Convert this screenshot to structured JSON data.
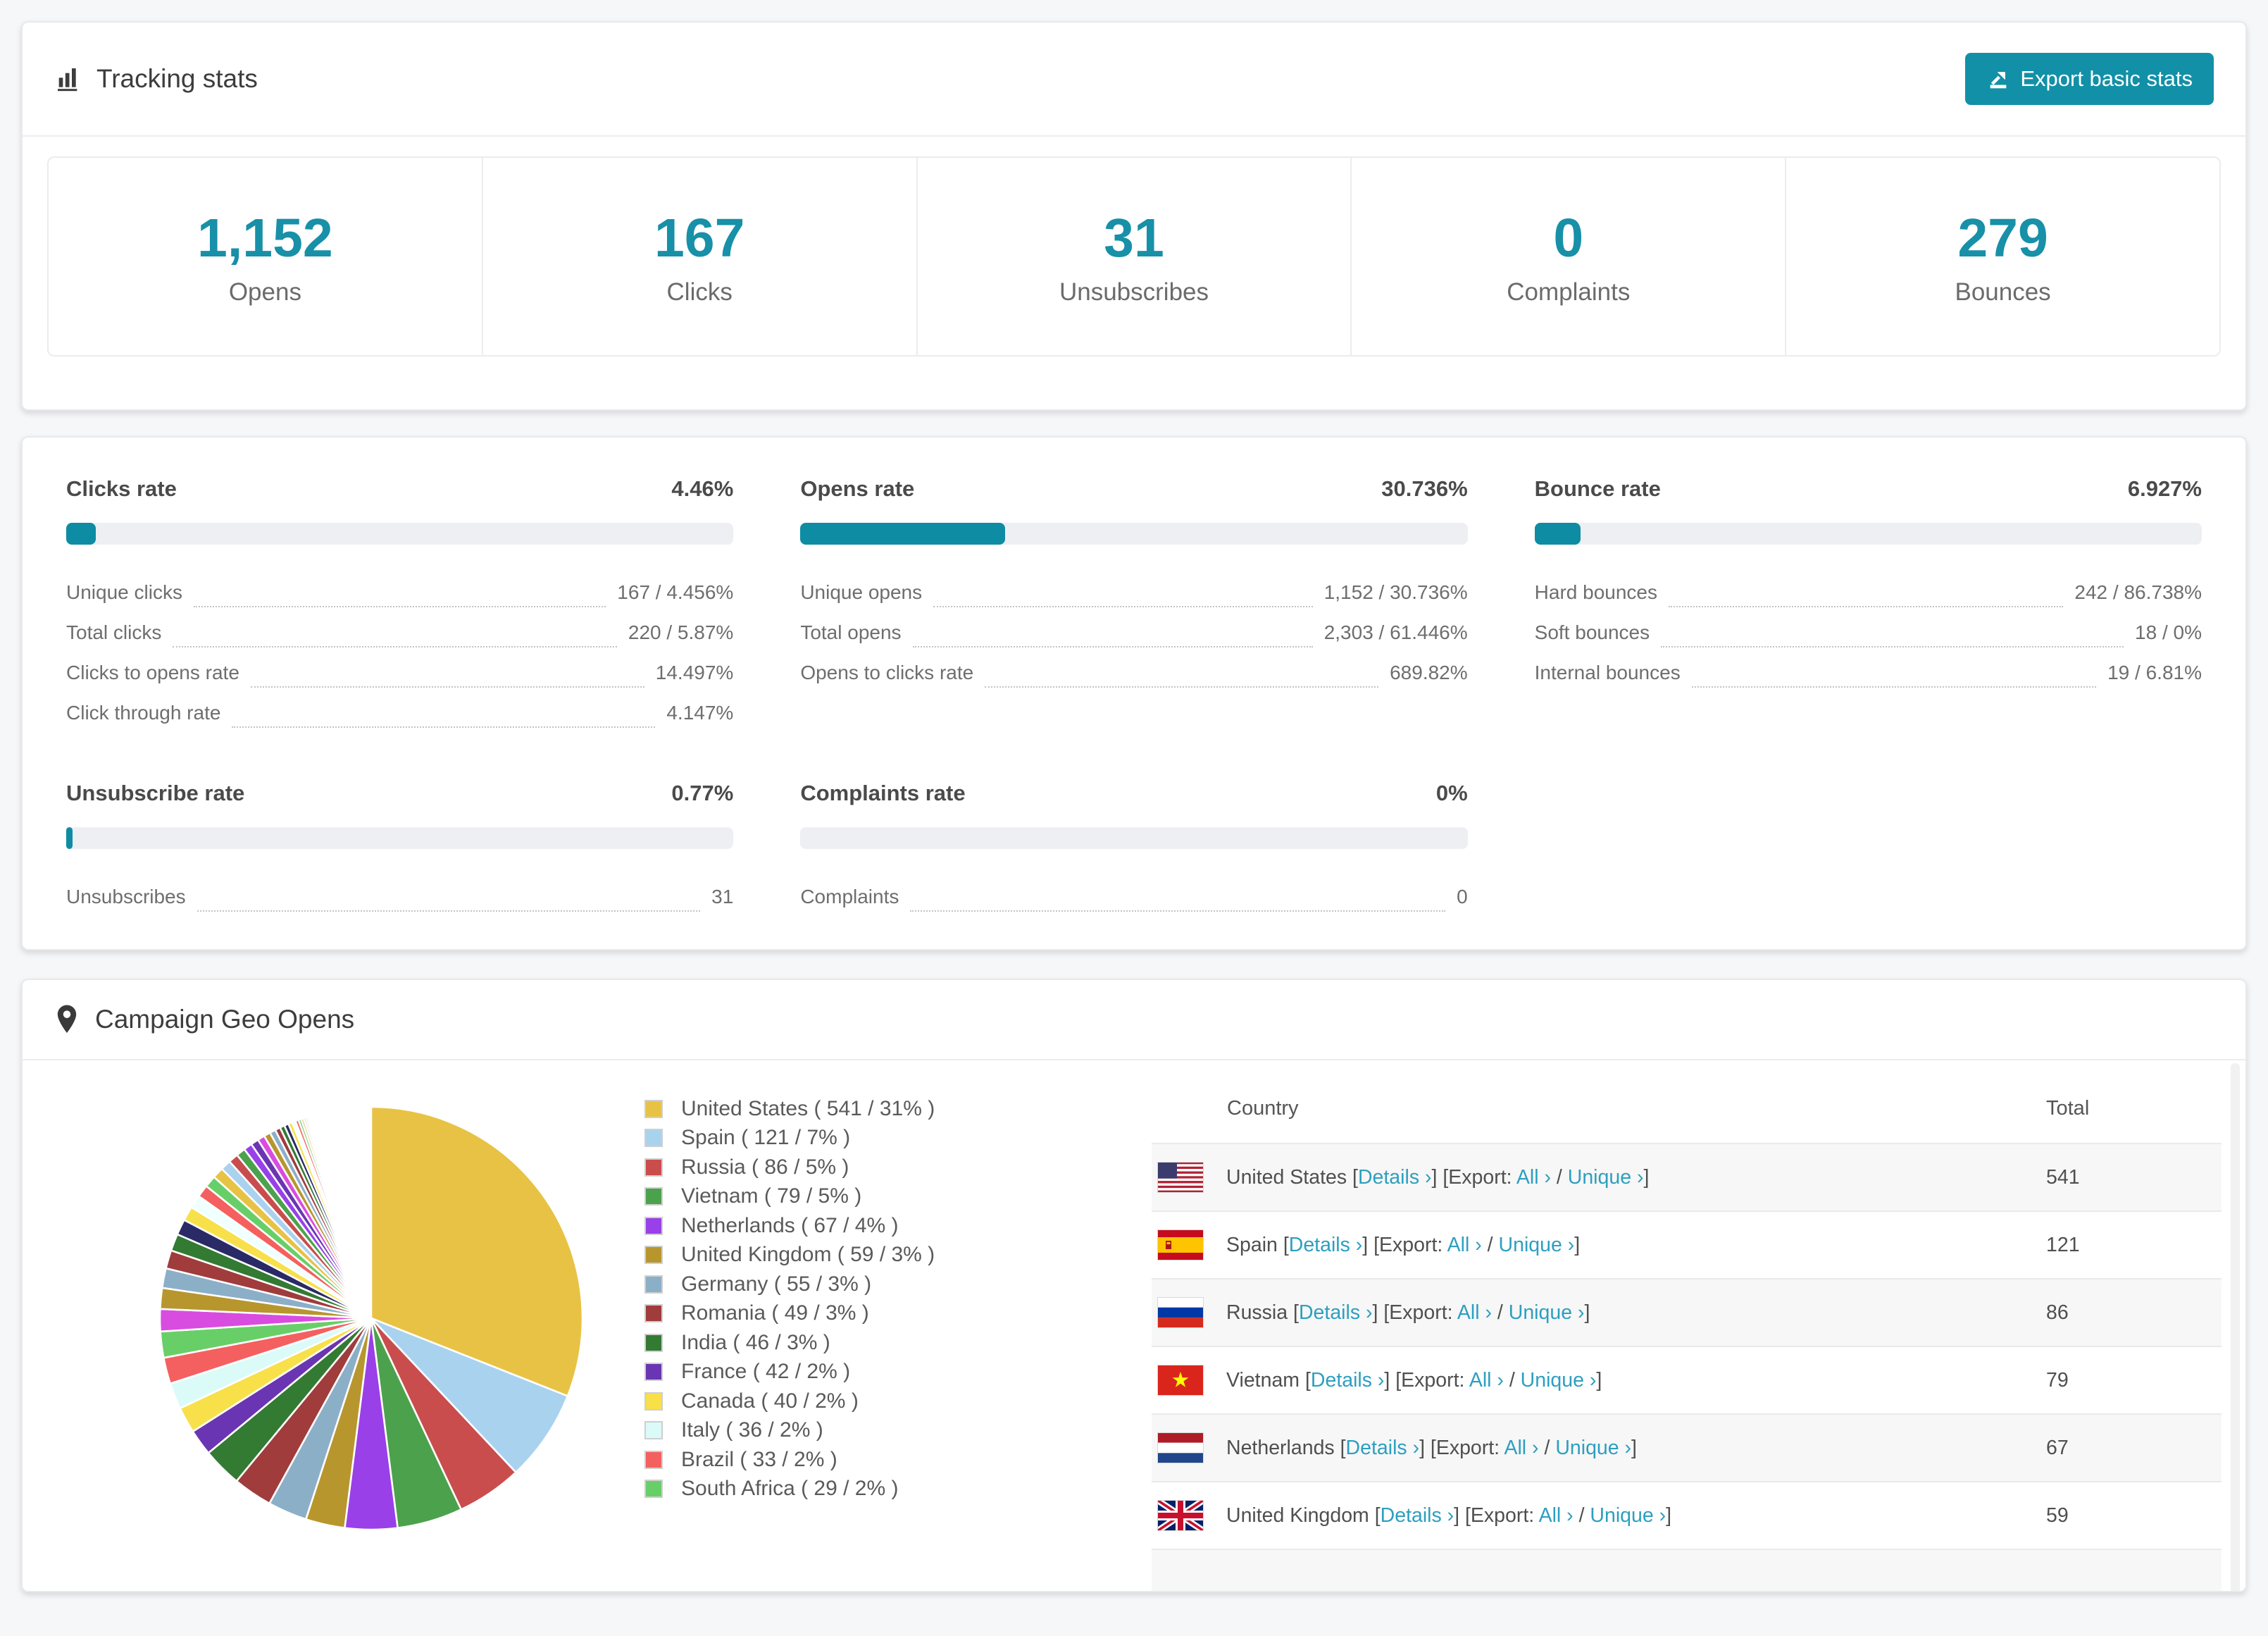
{
  "colors": {
    "accent_teal": "#1290a7",
    "number_teal": "#1790a8",
    "bar_fill": "#0e8ca4",
    "link": "#2d9fc0"
  },
  "tracking": {
    "title": "Tracking stats",
    "export_button": "Export basic stats",
    "stats": [
      {
        "value": "1,152",
        "label": "Opens"
      },
      {
        "value": "167",
        "label": "Clicks"
      },
      {
        "value": "31",
        "label": "Unsubscribes"
      },
      {
        "value": "0",
        "label": "Complaints"
      },
      {
        "value": "279",
        "label": "Bounces"
      }
    ]
  },
  "rates": {
    "blocks": [
      {
        "title": "Clicks rate",
        "value": "4.46%",
        "pct": 4.46,
        "rows": [
          {
            "label": "Unique clicks",
            "value": "167 / 4.456%"
          },
          {
            "label": "Total clicks",
            "value": "220 / 5.87%"
          },
          {
            "label": "Clicks to opens rate",
            "value": "14.497%"
          },
          {
            "label": "Click through rate",
            "value": "4.147%"
          }
        ]
      },
      {
        "title": "Opens rate",
        "value": "30.736%",
        "pct": 30.736,
        "rows": [
          {
            "label": "Unique opens",
            "value": "1,152 / 30.736%"
          },
          {
            "label": "Total opens",
            "value": "2,303 / 61.446%"
          },
          {
            "label": "Opens to clicks rate",
            "value": "689.82%"
          }
        ]
      },
      {
        "title": "Bounce rate",
        "value": "6.927%",
        "pct": 6.927,
        "rows": [
          {
            "label": "Hard bounces",
            "value": "242 / 86.738%"
          },
          {
            "label": "Soft bounces",
            "value": "18 / 0%"
          },
          {
            "label": "Internal bounces",
            "value": "19 / 6.81%"
          }
        ]
      },
      {
        "title": "Unsubscribe rate",
        "value": "0.77%",
        "pct": 0.77,
        "rows": [
          {
            "label": "Unsubscribes",
            "value": "31"
          }
        ]
      },
      {
        "title": "Complaints rate",
        "value": "0%",
        "pct": 0,
        "rows": [
          {
            "label": "Complaints",
            "value": "0"
          }
        ]
      }
    ]
  },
  "geo": {
    "title": "Campaign Geo Opens",
    "columns": {
      "country": "Country",
      "total": "Total"
    },
    "link_labels": {
      "open_bracket": "[",
      "close_bracket": "]",
      "details": "Details ›",
      "export": "[Export:",
      "all": "All ›",
      "slash": "/",
      "unique": "Unique ›"
    },
    "rows": [
      {
        "country": "United States",
        "flag": "us",
        "total": "541"
      },
      {
        "country": "Spain",
        "flag": "es",
        "total": "121"
      },
      {
        "country": "Russia",
        "flag": "ru",
        "total": "86"
      },
      {
        "country": "Vietnam",
        "flag": "vn",
        "total": "79"
      },
      {
        "country": "Netherlands",
        "flag": "nl",
        "total": "67"
      },
      {
        "country": "United Kingdom",
        "flag": "gb",
        "total": "59"
      }
    ],
    "partial_row": {
      "country": "Germany",
      "flag": "de"
    }
  },
  "chart_data": {
    "type": "pie",
    "title": "Campaign Geo Opens",
    "legend_position": "right",
    "labels": [
      "United States",
      "Spain",
      "Russia",
      "Vietnam",
      "Netherlands",
      "United Kingdom",
      "Germany",
      "Romania",
      "India",
      "France",
      "Canada",
      "Italy",
      "Brazil",
      "South Africa"
    ],
    "values": [
      541,
      121,
      86,
      79,
      67,
      59,
      55,
      49,
      46,
      42,
      40,
      36,
      33,
      29
    ],
    "percents": [
      31,
      7,
      5,
      5,
      4,
      3,
      3,
      3,
      3,
      2,
      2,
      2,
      2,
      2
    ],
    "colors": [
      "#e8c244",
      "#a9d2ef",
      "#c94d4d",
      "#4ca24c",
      "#9940e8",
      "#b8962e",
      "#8cafc8",
      "#a03c3c",
      "#337a33",
      "#6a35b2",
      "#f8e04b",
      "#dbfbf9",
      "#f4605f",
      "#68cf68"
    ],
    "legend": [
      "United States ( 541 / 31% )",
      "Spain ( 121 / 7% )",
      "Russia ( 86 / 5% )",
      "Vietnam ( 79 / 5% )",
      "Netherlands ( 67 / 4% )",
      "United Kingdom ( 59 / 3% )",
      "Germany ( 55 / 3% )",
      "Romania ( 49 / 3% )",
      "India ( 46 / 3% )",
      "France ( 42 / 2% )",
      "Canada ( 40 / 2% )",
      "Italy ( 36 / 2% )",
      "Brazil ( 33 / 2% )",
      "South Africa ( 29 / 2% )"
    ],
    "others_percents": [
      1.7,
      1.6,
      1.5,
      1.4,
      1.3,
      1.2,
      1.1,
      1.0,
      0.95,
      0.9,
      0.85,
      0.8,
      0.75,
      0.7,
      0.65,
      0.6,
      0.55,
      0.5,
      0.45,
      0.4,
      0.36,
      0.33,
      0.3,
      0.27,
      0.24,
      0.21,
      0.19,
      0.17,
      0.15,
      0.13,
      0.11,
      0.1,
      0.09,
      0.08,
      0.07,
      0.06,
      0.05,
      0.04,
      0.03,
      0.03,
      0.02,
      0.02,
      0.01,
      0.01
    ],
    "others_colors": [
      "#d94ce0",
      "#b8962e",
      "#8cafc8",
      "#a03c3c",
      "#337a33",
      "#2a2a66",
      "#f8e04b",
      "#f0ffff",
      "#f4605f",
      "#68cf68",
      "#e8c244",
      "#a9d2ef",
      "#c94d4d",
      "#4ca24c",
      "#9940e8",
      "#6a35b2"
    ]
  }
}
